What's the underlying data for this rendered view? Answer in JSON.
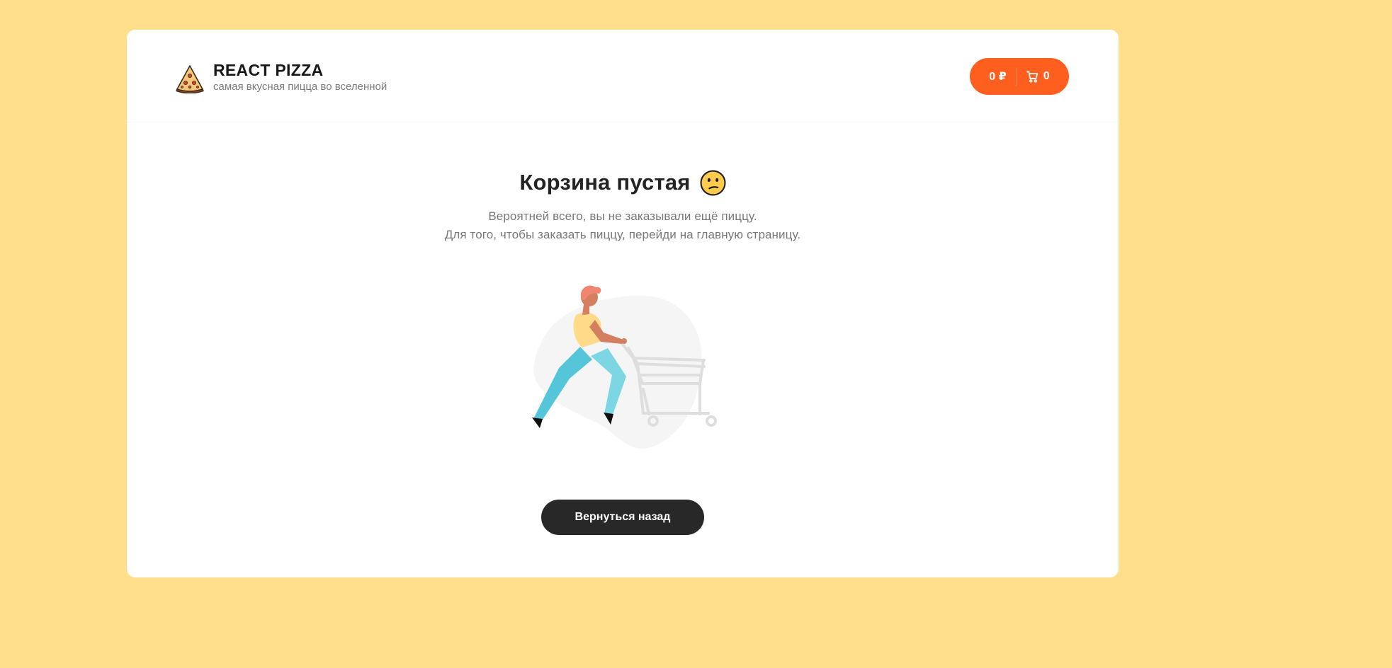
{
  "header": {
    "logo_title": "REACT PIZZA",
    "logo_subtitle": "самая вкусная пицца во вселенной",
    "cart": {
      "price": "0 ₽",
      "count": "0",
      "icon": "cart-icon"
    }
  },
  "empty_cart": {
    "title": "Корзина пустая",
    "emoji": "confused-face-emoji",
    "line1": "Вероятней всего, вы не заказывали ещё пиццу.",
    "line2": "Для того, чтобы заказать пиццу, перейди на главную страницу.",
    "illustration": "person-pushing-empty-cart-illustration",
    "back_button": "Вернуться назад"
  },
  "colors": {
    "background": "#ffdf8c",
    "accent": "#fe5f1e",
    "button_dark": "#282828"
  }
}
